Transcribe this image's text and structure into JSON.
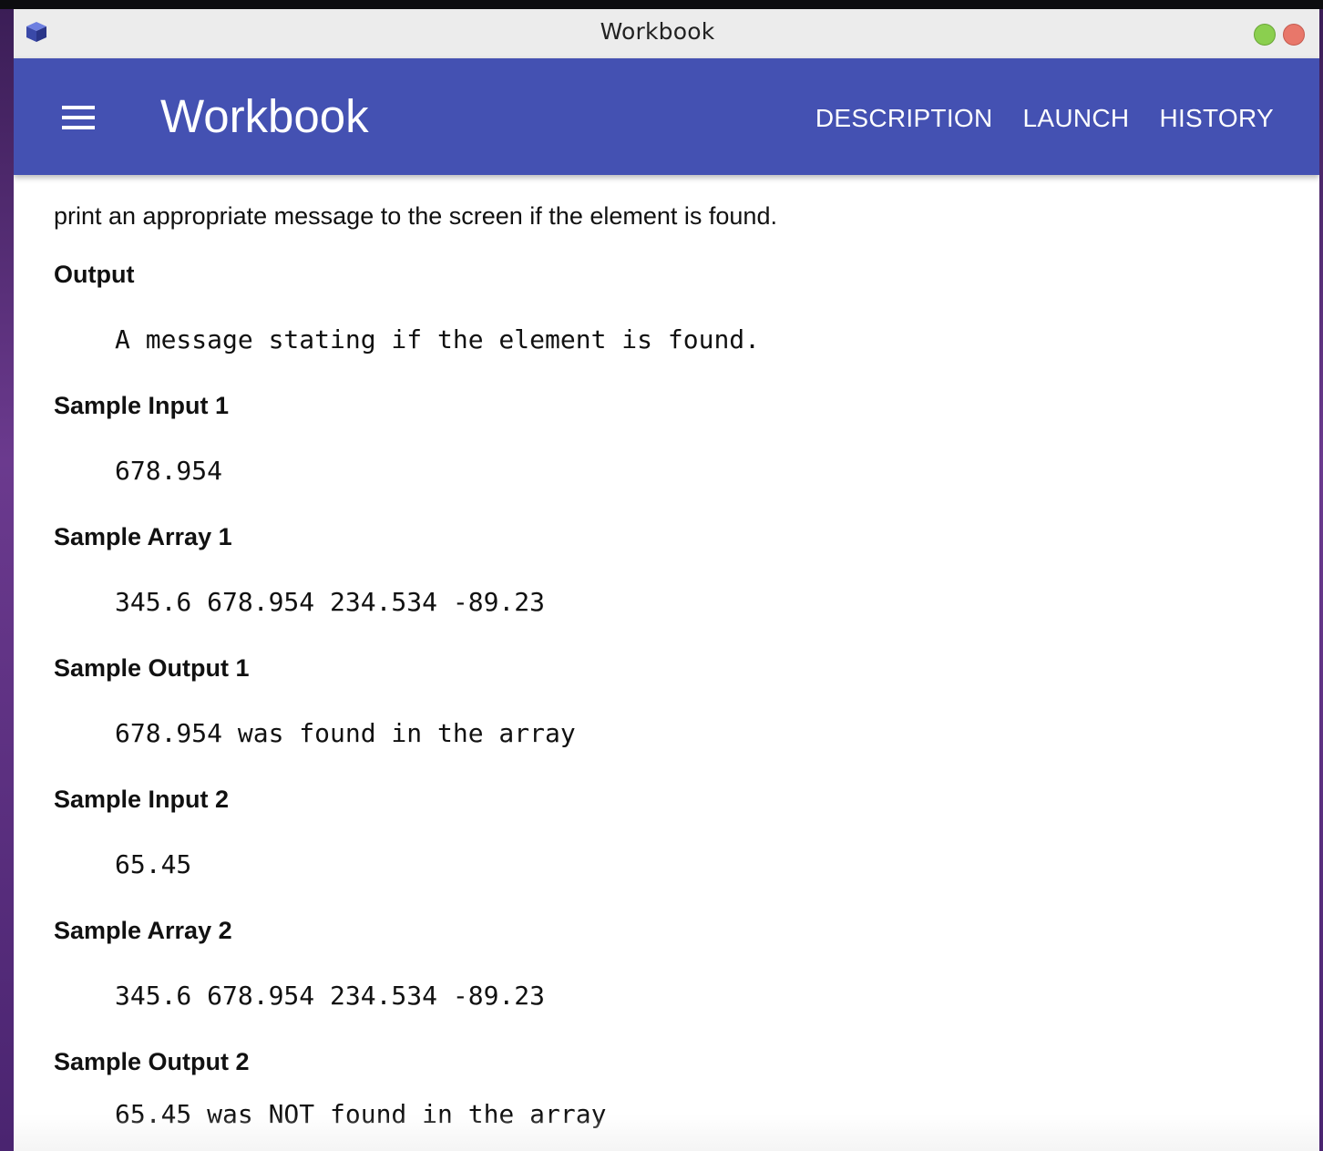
{
  "window": {
    "title": "Workbook"
  },
  "appbar": {
    "title": "Workbook",
    "nav": [
      "DESCRIPTION",
      "LAUNCH",
      "HISTORY"
    ]
  },
  "content": {
    "intro": "print an appropriate message to the screen if the element is found.",
    "sections": [
      {
        "heading": "Output",
        "code": "A message stating if the element is found."
      },
      {
        "heading": "Sample Input 1",
        "code": "678.954"
      },
      {
        "heading": "Sample Array 1",
        "code": "345.6 678.954 234.534 -89.23"
      },
      {
        "heading": "Sample Output 1",
        "code": "678.954 was found in the array"
      },
      {
        "heading": "Sample Input 2",
        "code": "65.45"
      },
      {
        "heading": "Sample Array 2",
        "code": "345.6 678.954 234.534 -89.23"
      },
      {
        "heading": "Sample Output 2",
        "code": "65.45 was NOT found in the array"
      }
    ]
  },
  "icons": {
    "app": "cube-icon",
    "menu": "hamburger-menu-icon"
  },
  "colors": {
    "appbar": "#4451b2",
    "titlebar": "#ececec",
    "maximize_button": "#8bcf4f",
    "close_button": "#e8776a"
  }
}
